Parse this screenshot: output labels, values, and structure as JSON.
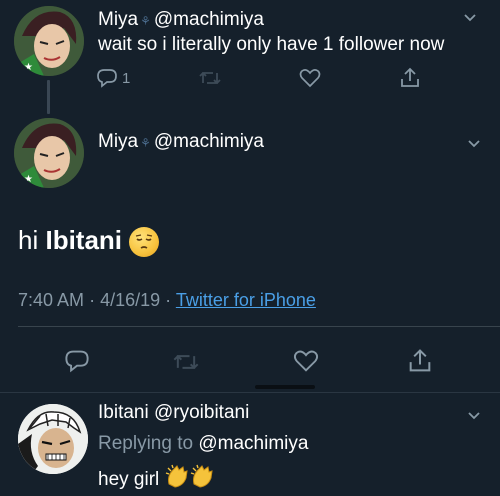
{
  "tweet1": {
    "display_name": "Miya",
    "badge": "⚘",
    "handle": "@machimiya",
    "text": "wait so i literally only have 1 follower now",
    "reply_count": "1"
  },
  "tweet2": {
    "display_name": "Miya",
    "badge": "⚘",
    "handle": "@machimiya",
    "text_prefix": "hi ",
    "text_name": "Ibitani",
    "emoji": "pensive-face",
    "time": "7:40 AM",
    "sep1": "·",
    "date": "4/16/19",
    "sep2": "·",
    "source": "Twitter for iPhone"
  },
  "reply": {
    "display_name": "Ibitani",
    "handle": "@ryoibitani",
    "replying_label": "Replying to",
    "replying_to": "@machimiya",
    "text": "hey girl",
    "emoji": "clapping-hands"
  },
  "colors": {
    "background": "#15202b",
    "text": "#ffffff",
    "secondary": "#8899a6",
    "link": "#4a9fe6",
    "divider": "#38444d"
  }
}
